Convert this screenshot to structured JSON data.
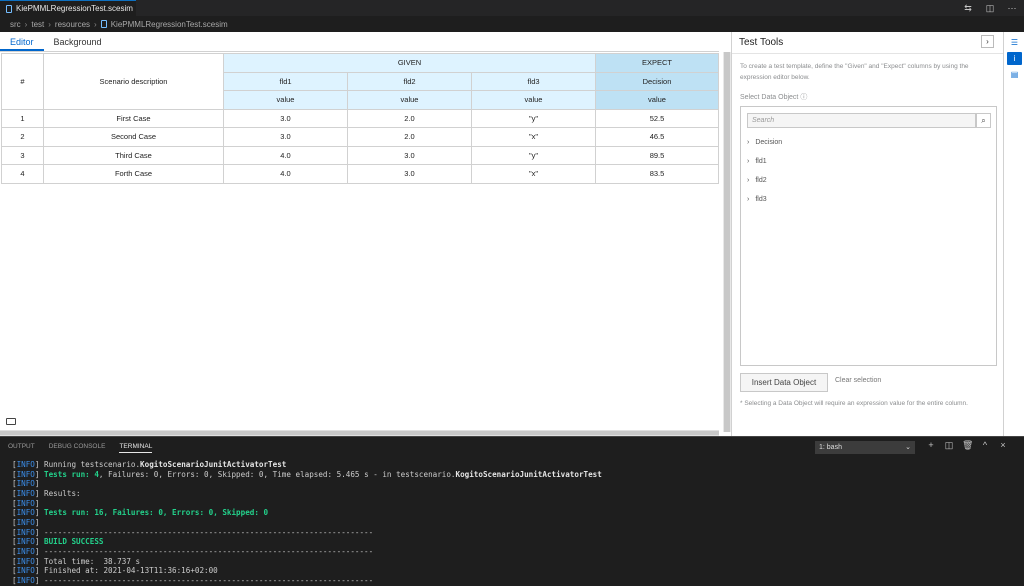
{
  "tab": {
    "title": "KiePMMLRegressionTest.scesim"
  },
  "breadcrumb": [
    "src",
    "test",
    "resources",
    "KiePMMLRegressionTest.scesim"
  ],
  "editor": {
    "tabs": [
      "Editor",
      "Background"
    ],
    "headers": {
      "index": "#",
      "description": "Scenario description",
      "given": "GIVEN",
      "expect": "EXPECT",
      "cols": [
        "fld1",
        "fld2",
        "fld3",
        "Decision"
      ],
      "value_label": "value"
    },
    "rows": [
      {
        "index": "1",
        "description": "First Case",
        "fld1": "3.0",
        "fld2": "2.0",
        "fld3": "\"y\"",
        "decision": "52.5"
      },
      {
        "index": "2",
        "description": "Second Case",
        "fld1": "3.0",
        "fld2": "2.0",
        "fld3": "\"x\"",
        "decision": "46.5"
      },
      {
        "index": "3",
        "description": "Third Case",
        "fld1": "4.0",
        "fld2": "3.0",
        "fld3": "\"y\"",
        "decision": "89.5"
      },
      {
        "index": "4",
        "description": "Forth Case",
        "fld1": "4.0",
        "fld2": "3.0",
        "fld3": "\"x\"",
        "decision": "83.5"
      }
    ]
  },
  "tools": {
    "title": "Test Tools",
    "description": "To create a test template, define the \"Given\" and \"Expect\" columns by using the expression editor below.",
    "select_header": "Select Data Object",
    "search_placeholder": "Search",
    "tree": [
      "Decision",
      "fld1",
      "fld2",
      "fld3"
    ],
    "insert_button": "Insert Data Object",
    "clear_selection": "Clear selection",
    "note": "* Selecting a Data Object will require an expression value for the entire column."
  },
  "panel": {
    "tabs": [
      "OUTPUT",
      "DEBUG CONSOLE",
      "TERMINAL"
    ],
    "terminal_select": "1: bash"
  },
  "terminal": {
    "info": "INFO",
    "l1_text": " Running testscenario.",
    "l1_bold": "KogitoScenarioJunitActivatorTest",
    "l2_green": "Tests run: ",
    "l2_count": "4",
    "l2_rest": ", Failures: 0, Errors: 0, Skipped: 0, Time elapsed: 5.465 s - in testscenario.",
    "l2_bold": "KogitoScenarioJunitActivatorTest",
    "results": " Results:",
    "summary": "Tests run: 16, Failures: 0, Errors: 0, Skipped: 0",
    "dashes": " ------------------------------------------------------------------------",
    "build": "BUILD SUCCESS",
    "total": " Total time:  38.737 s",
    "finished": " Finished at: 2021-04-13T11:36:16+02:00"
  }
}
